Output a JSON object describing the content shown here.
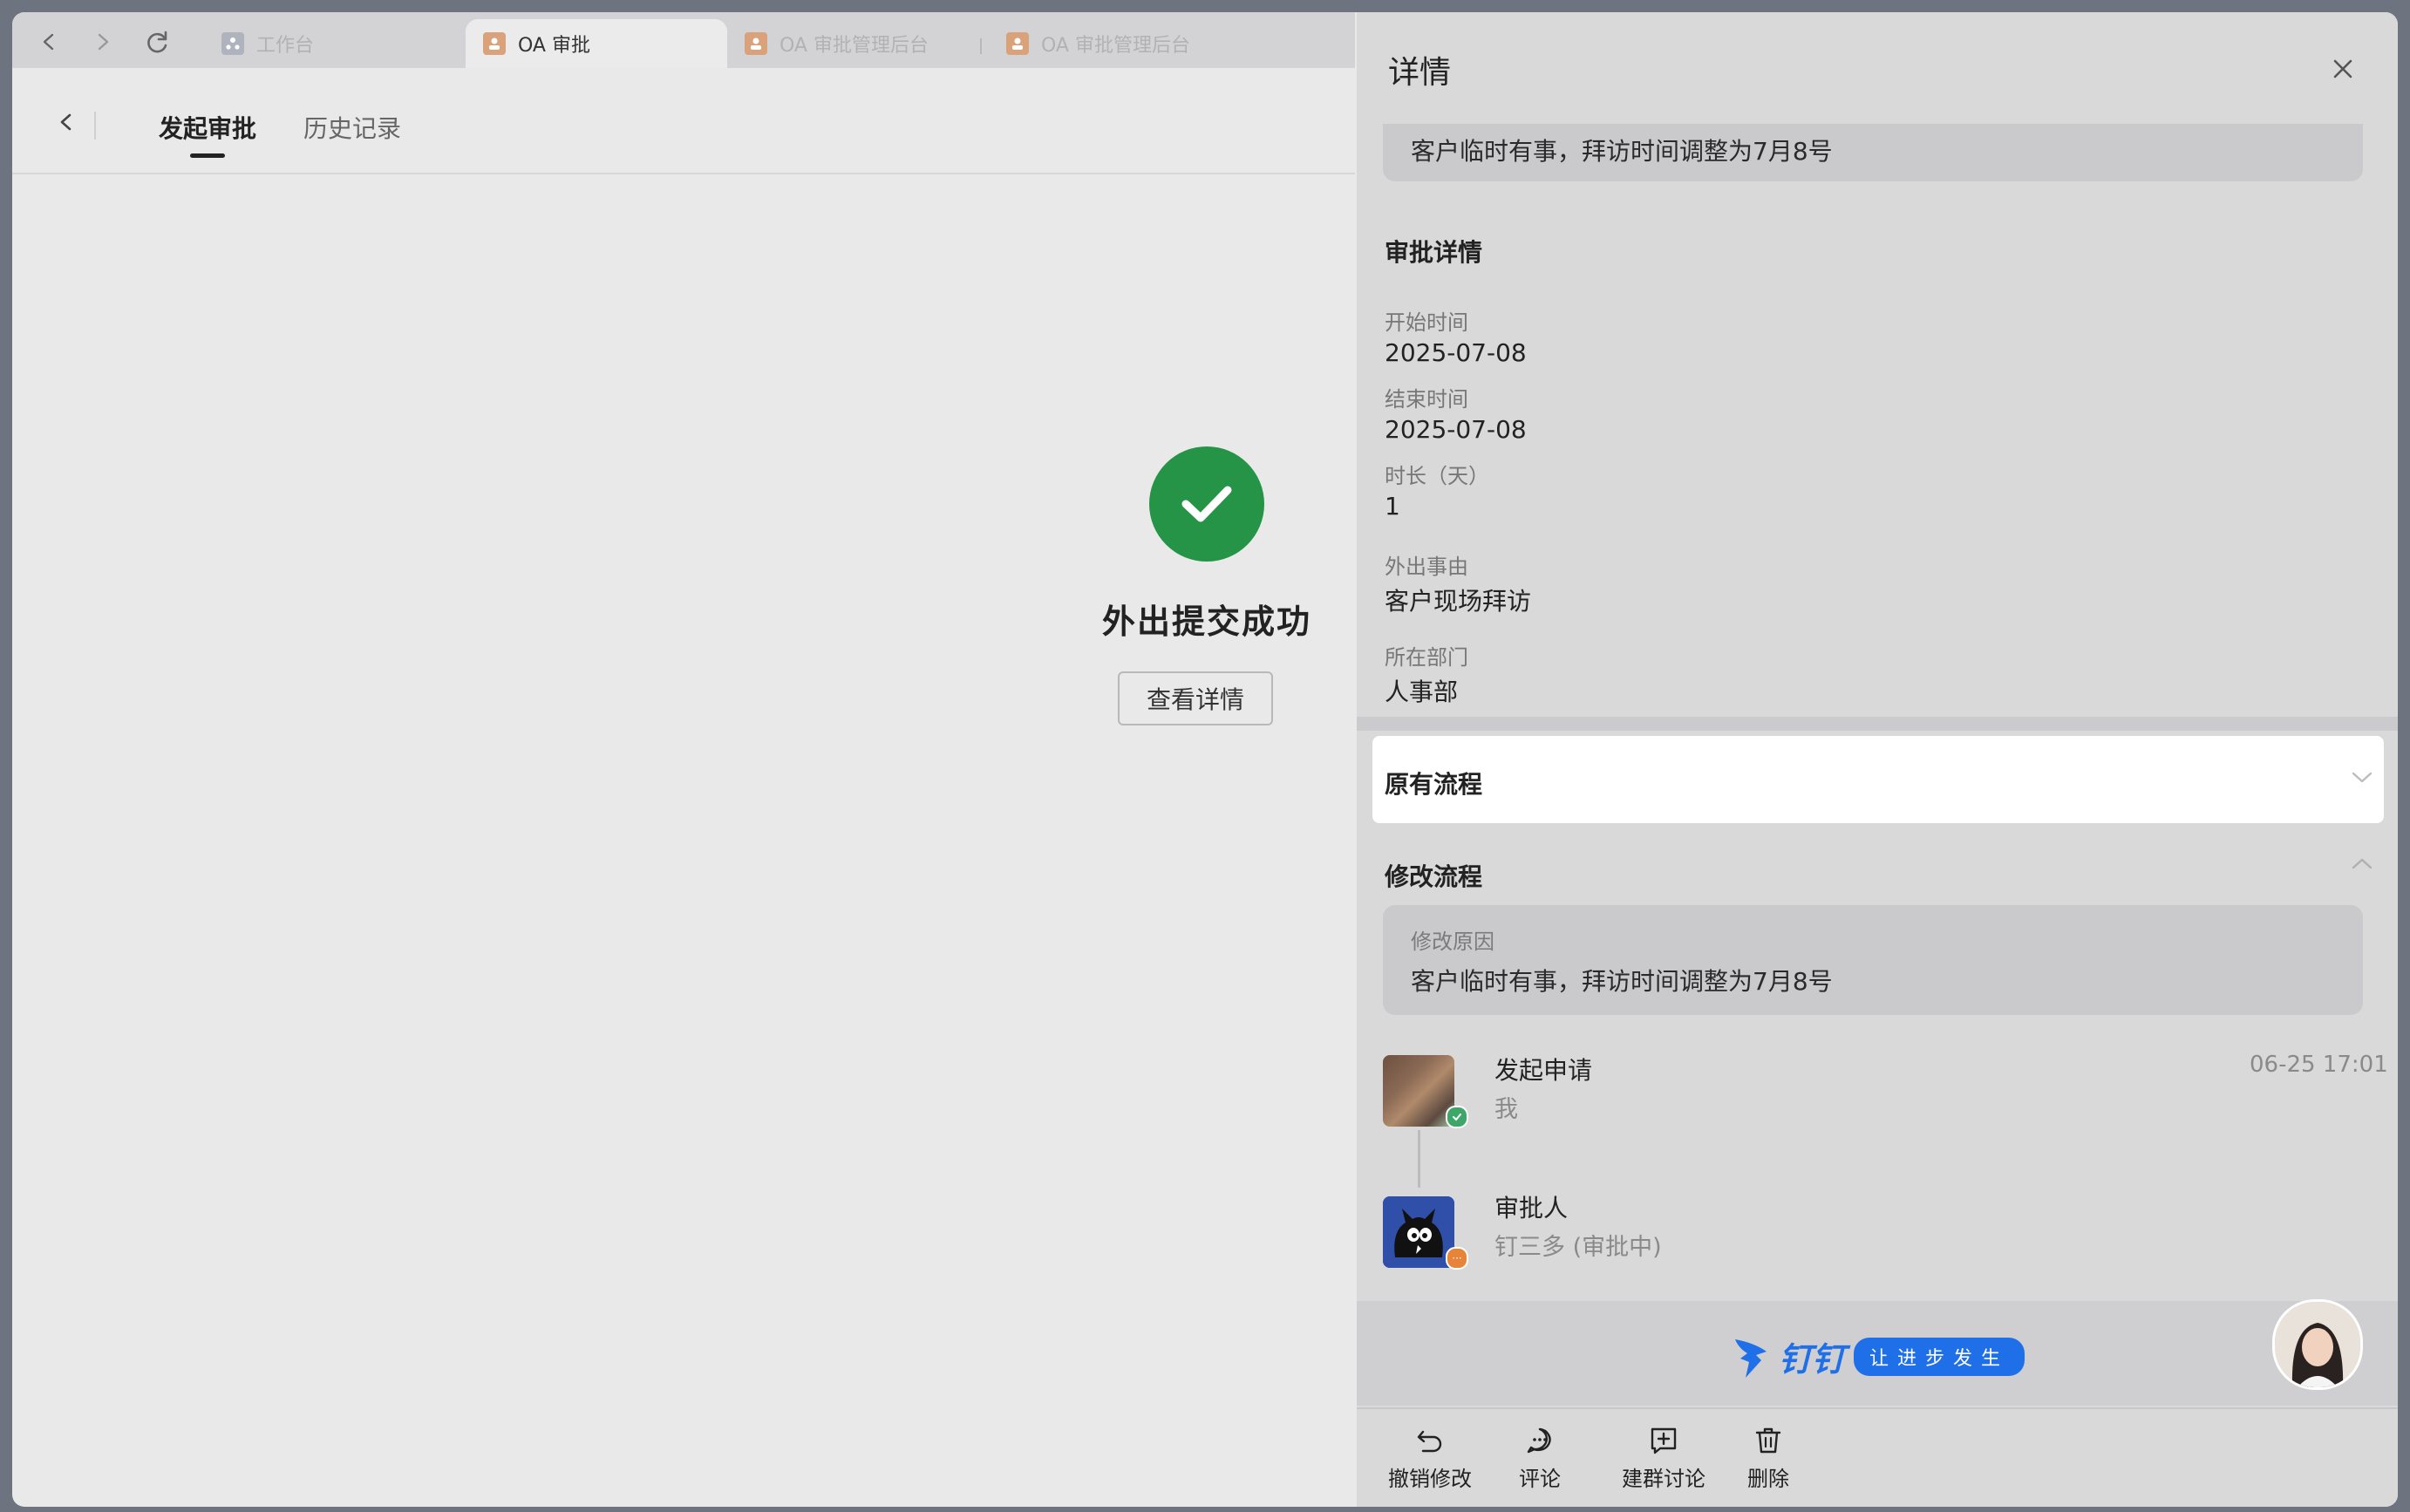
{
  "tabs": {
    "items": [
      {
        "label": "工作台"
      },
      {
        "label": "OA 审批"
      },
      {
        "label": "OA 审批管理后台"
      },
      {
        "label": "OA 审批管理后台"
      }
    ]
  },
  "subnav": {
    "tab_start": "发起审批",
    "tab_history": "历史记录"
  },
  "main": {
    "success_title": "外出提交成功",
    "detail_button": "查看详情"
  },
  "panel": {
    "title": "详情",
    "top_reason": "客户临时有事，拜访时间调整为7月8号",
    "approval_section": "审批详情",
    "fields": [
      {
        "label": "开始时间",
        "value": "2025-07-08"
      },
      {
        "label": "结束时间",
        "value": "2025-07-08"
      },
      {
        "label": "时长（天）",
        "value": "1"
      },
      {
        "label": "外出事由",
        "value": "客户现场拜访"
      },
      {
        "label": "所在部门",
        "value": "人事部"
      }
    ],
    "original_flow": "原有流程",
    "modified_flow": "修改流程",
    "reason_label": "修改原因",
    "reason_value": "客户临时有事，拜访时间调整为7月8号",
    "steps": [
      {
        "name": "发起申请",
        "sub": "我",
        "time": "06-25 17:01"
      },
      {
        "name": "审批人",
        "sub": "钉三多 (审批中)"
      }
    ],
    "brand": {
      "name": "钉钉",
      "slogan": "让进步发生"
    },
    "footer": [
      {
        "label": "撤销修改",
        "icon": "undo-icon"
      },
      {
        "label": "评论",
        "icon": "comment-icon"
      },
      {
        "label": "建群讨论",
        "icon": "group-chat-icon"
      },
      {
        "label": "删除",
        "icon": "trash-icon"
      }
    ]
  },
  "colors": {
    "success": "#259446",
    "brand": "#1f6fe8",
    "badge": "#e6843a"
  }
}
